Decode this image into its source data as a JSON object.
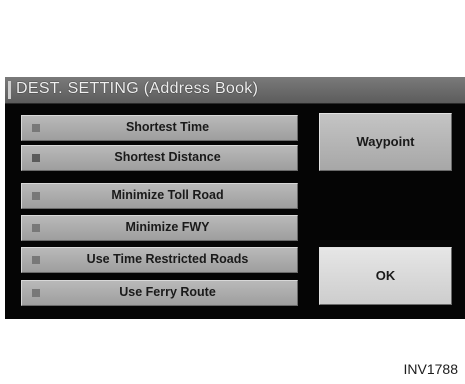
{
  "title": "DEST. SETTING (Address Book)",
  "options": [
    {
      "label": "Shortest Time",
      "selected": false
    },
    {
      "label": "Shortest Distance",
      "selected": true
    },
    {
      "label": "Minimize Toll Road",
      "selected": false
    },
    {
      "label": "Minimize FWY",
      "selected": false
    },
    {
      "label": "Use Time Restricted Roads",
      "selected": false
    },
    {
      "label": "Use Ferry Route",
      "selected": false
    }
  ],
  "buttons": {
    "waypoint": "Waypoint",
    "ok": "OK"
  },
  "figure_code": "INV1788"
}
